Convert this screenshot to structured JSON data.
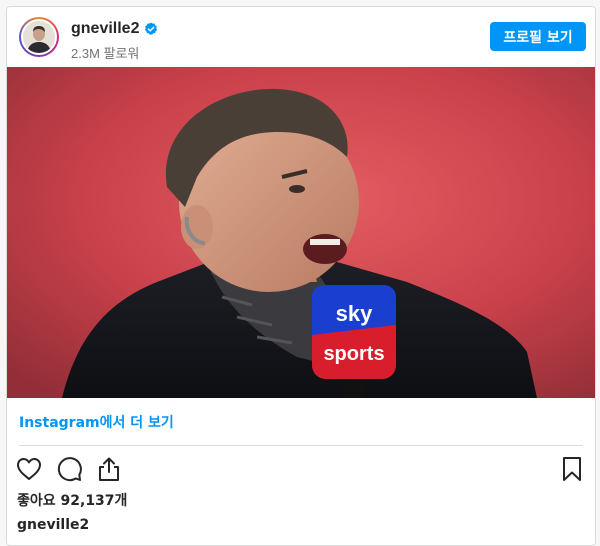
{
  "header": {
    "username": "gneville2",
    "verified_icon": "verified-badge-icon",
    "followers": "2.3M 팔로워",
    "profile_button": "프로필 보기"
  },
  "photo": {
    "mic_brand_top": "sky",
    "mic_brand_bottom": "sports",
    "accent_blue": "#1a3fd0",
    "accent_red": "#d81e2c"
  },
  "footer": {
    "more_link": "Instagram에서 더 보기",
    "likes": "좋아요 92,137개",
    "caption_username": "gneville2"
  },
  "icons": {
    "like": "heart-icon",
    "comment": "comment-icon",
    "share": "share-icon",
    "save": "bookmark-icon"
  },
  "colors": {
    "link_blue": "#0095f6",
    "button_blue": "#0095f6",
    "text": "#262626",
    "muted": "#737373"
  }
}
